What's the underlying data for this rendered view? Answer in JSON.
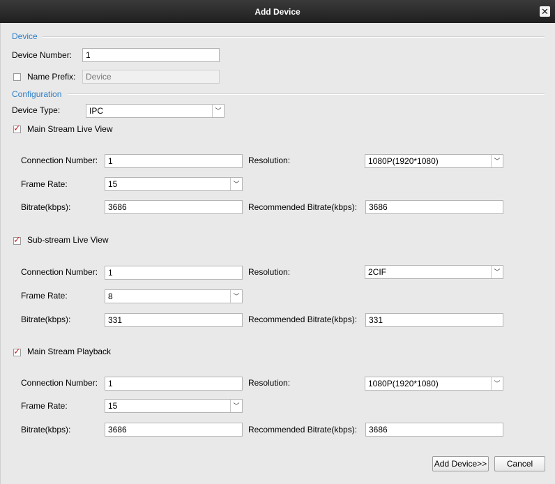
{
  "window": {
    "title": "Add Device"
  },
  "sections": {
    "device": "Device",
    "configuration": "Configuration"
  },
  "device": {
    "number_label": "Device Number:",
    "number_value": "1",
    "prefix_label": "Name Prefix:",
    "prefix_placeholder": "Device",
    "prefix_checked": false
  },
  "config": {
    "type_label": "Device Type:",
    "type_value": "IPC"
  },
  "labels": {
    "connection": "Connection Number:",
    "resolution": "Resolution:",
    "frame_rate": "Frame Rate:",
    "bitrate": "Bitrate(kbps):",
    "recommended": "Recommended Bitrate(kbps):"
  },
  "main_live": {
    "title": "Main Stream Live View",
    "checked": true,
    "connection": "1",
    "resolution": "1080P(1920*1080)",
    "frame_rate": "15",
    "bitrate": "3686",
    "recommended": "3686"
  },
  "sub_live": {
    "title": "Sub-stream Live View",
    "checked": true,
    "connection": "1",
    "resolution": "2CIF",
    "frame_rate": "8",
    "bitrate": "331",
    "recommended": "331"
  },
  "main_playback": {
    "title": "Main Stream Playback",
    "checked": true,
    "connection": "1",
    "resolution": "1080P(1920*1080)",
    "frame_rate": "15",
    "bitrate": "3686",
    "recommended": "3686"
  },
  "buttons": {
    "add": "Add Device>>",
    "cancel": "Cancel"
  },
  "icons": {
    "close": "close-icon",
    "check": "check-icon",
    "dropdown": "chevron-down-icon"
  }
}
